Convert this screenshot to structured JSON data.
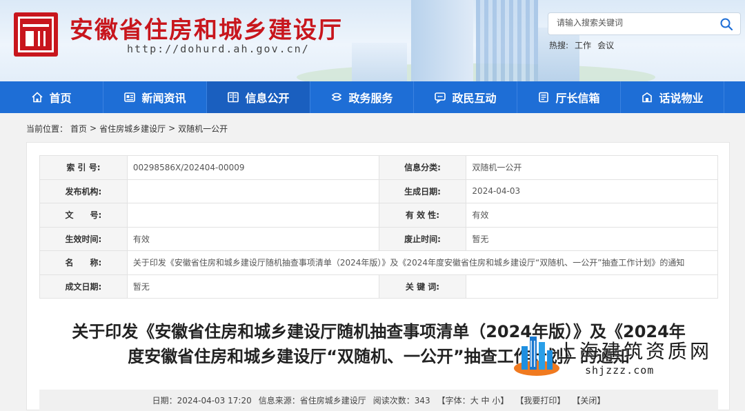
{
  "header": {
    "site_title": "安徽省住房和城乡建设厅",
    "site_url": "http://dohurd.ah.gov.cn/",
    "search_placeholder": "请输入搜索关键词",
    "hot_label": "热搜:",
    "hot_words": [
      "工作",
      "会议"
    ],
    "brand_color": "#c8161d"
  },
  "nav": {
    "items": [
      {
        "label": "首页",
        "icon": "home-icon"
      },
      {
        "label": "新闻资讯",
        "icon": "news-icon"
      },
      {
        "label": "信息公开",
        "icon": "document-icon"
      },
      {
        "label": "政务服务",
        "icon": "service-icon"
      },
      {
        "label": "政民互动",
        "icon": "chat-icon"
      },
      {
        "label": "厅长信箱",
        "icon": "mailbox-icon"
      },
      {
        "label": "话说物业",
        "icon": "building-icon"
      }
    ],
    "active_index": 2,
    "color": "#1e6ed6"
  },
  "breadcrumb": {
    "prefix": "当前位置：",
    "items": [
      "首页",
      "省住房城乡建设厅",
      "双随机一公开"
    ],
    "sep": ">"
  },
  "meta": {
    "rows": [
      {
        "k1": "索 引 号:",
        "v1": "00298586X/202404-00009",
        "k2": "信息分类:",
        "v2": "双随机一公开"
      },
      {
        "k1": "发布机构:",
        "v1": "",
        "k2": "生成日期:",
        "v2": "2024-04-03"
      },
      {
        "k1": "文　　号:",
        "v1": "",
        "k2": "有 效 性:",
        "v2": "有效"
      },
      {
        "k1": "生效时间:",
        "v1": "有效",
        "k2": "废止时间:",
        "v2": "暂无"
      },
      {
        "k1": "名　　称:",
        "v1": "关于印发《安徽省住房和城乡建设厅随机抽查事项清单（2024年版）》及《2024年度安徽省住房和城乡建设厅“双随机、一公开”抽查工作计划》的通知"
      },
      {
        "k1": "成文日期:",
        "v1": "暂无",
        "k2": "关 键 词:",
        "v2": ""
      }
    ]
  },
  "article": {
    "title_line1": "关于印发《安徽省住房和城乡建设厅随机抽查事项清单（2024年版）》及《2024年",
    "title_line2": "度安徽省住房和城乡建设厅“双随机、一公开”抽查工作计划》的通知",
    "date_label": "日期：",
    "date": "2024-04-03 17:20",
    "source_label": "信息来源：",
    "source": "省住房城乡建设厅",
    "views_label": "阅读次数：",
    "views": "343",
    "font_label": "【字体：",
    "font_big": "大",
    "font_mid": "中",
    "font_small": "小",
    "font_end": "】",
    "print": "【我要打印】",
    "close": "【关闭】"
  },
  "watermark": {
    "text": "上海建筑资质网",
    "url": "shjzzz.com"
  }
}
